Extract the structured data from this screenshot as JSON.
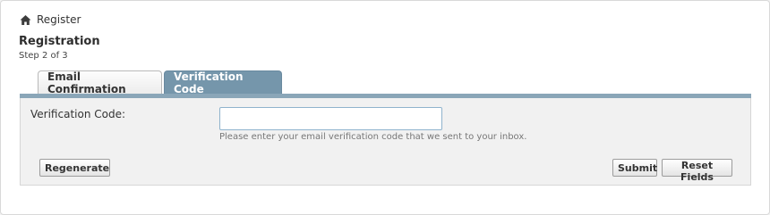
{
  "breadcrumb": {
    "icon": "home-icon",
    "label": "Register"
  },
  "header": {
    "title": "Registration",
    "step": "Step 2 of 3"
  },
  "tabs": [
    {
      "label": "Email Confirmation",
      "active": false
    },
    {
      "label": "Verification Code",
      "active": true
    }
  ],
  "form": {
    "code_label": "Verification Code:",
    "code_value": "",
    "code_placeholder": "",
    "help_text": "Please enter your email verification code that we sent to your inbox."
  },
  "buttons": {
    "regenerate": "Regenerate",
    "submit": "Submit",
    "reset": "Reset Fields"
  },
  "colors": {
    "active_tab": "#7596ab",
    "tab_strip": "#8aa6b8",
    "input_border": "#8fb3cd"
  }
}
